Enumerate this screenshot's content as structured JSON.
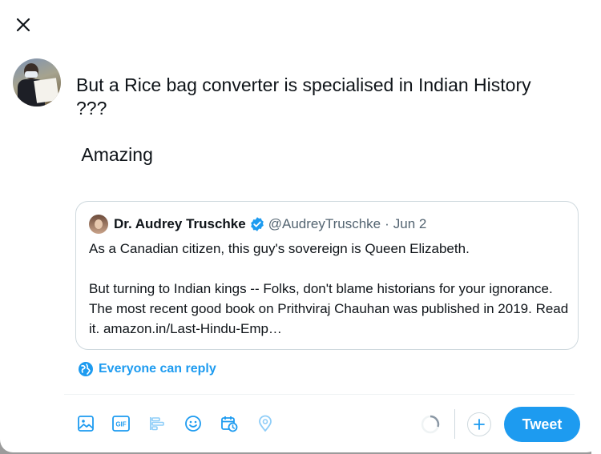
{
  "compose": {
    "text": "But a Rice bag converter is specialised in Indian History\n???\n\n Amazing"
  },
  "quote": {
    "name": "Dr. Audrey Truschke",
    "handle": "@AudreyTruschke",
    "separator": "·",
    "date": "Jun 2",
    "body": "As a Canadian citizen, this guy's sovereign is Queen Elizabeth.\n\nBut turning to Indian kings -- Folks, don't blame historians for your ignorance. The most recent good book on Prithviraj Chauhan was published in 2019. Read it. amazon.in/Last-Hindu-Emp…"
  },
  "reply_setting": {
    "label": "Everyone can reply"
  },
  "toolbar": {
    "icons": [
      "media-icon",
      "gif-icon",
      "poll-icon",
      "emoji-icon",
      "schedule-icon",
      "location-icon"
    ],
    "tweet_label": "Tweet"
  },
  "colors": {
    "accent": "#1d9bf0",
    "text": "#0f1419",
    "secondary": "#536471",
    "border": "#cfd9de"
  }
}
